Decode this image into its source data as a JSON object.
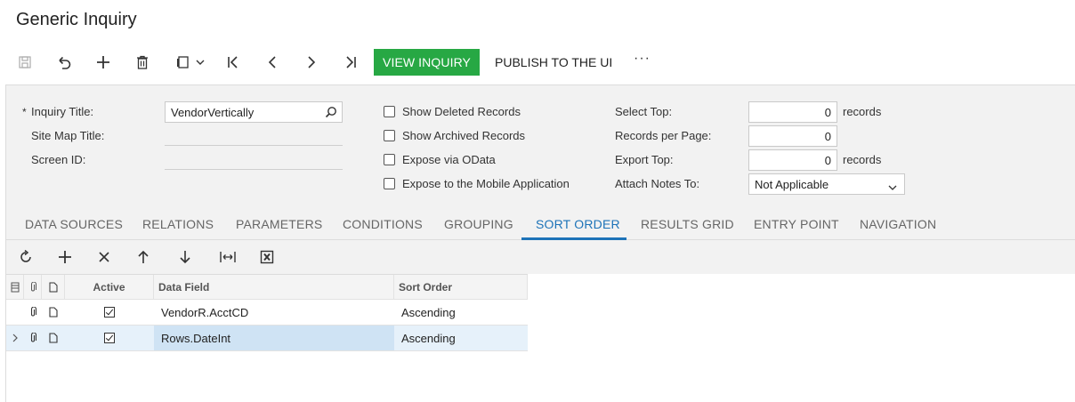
{
  "page": {
    "title": "Generic Inquiry"
  },
  "toolbar": {
    "view_inquiry": "VIEW INQUIRY",
    "publish": "PUBLISH TO THE UI",
    "more": "···"
  },
  "form": {
    "inquiry_title_label": "Inquiry Title:",
    "inquiry_title_value": "VendorVertically",
    "site_map_title_label": "Site Map Title:",
    "screen_id_label": "Screen ID:",
    "show_deleted_label": "Show Deleted Records",
    "show_archived_label": "Show Archived Records",
    "expose_odata_label": "Expose via OData",
    "expose_mobile_label": "Expose to the Mobile Application",
    "select_top_label": "Select Top:",
    "select_top_value": "0",
    "records_per_page_label": "Records per Page:",
    "records_per_page_value": "0",
    "export_top_label": "Export Top:",
    "export_top_value": "0",
    "records_suffix": "records",
    "attach_notes_label": "Attach Notes To:",
    "attach_notes_value": "Not Applicable",
    "required_mark": "*"
  },
  "tabs": [
    "DATA SOURCES",
    "RELATIONS",
    "PARAMETERS",
    "CONDITIONS",
    "GROUPING",
    "SORT ORDER",
    "RESULTS GRID",
    "ENTRY POINT",
    "NAVIGATION"
  ],
  "active_tab": "SORT ORDER",
  "grid": {
    "columns": {
      "active": "Active",
      "data_field": "Data Field",
      "sort_order": "Sort Order"
    },
    "rows": [
      {
        "active": true,
        "data_field": "VendorR.AcctCD",
        "sort_order": "Ascending"
      },
      {
        "active": true,
        "data_field": "Rows.DateInt",
        "sort_order": "Ascending"
      }
    ]
  }
}
